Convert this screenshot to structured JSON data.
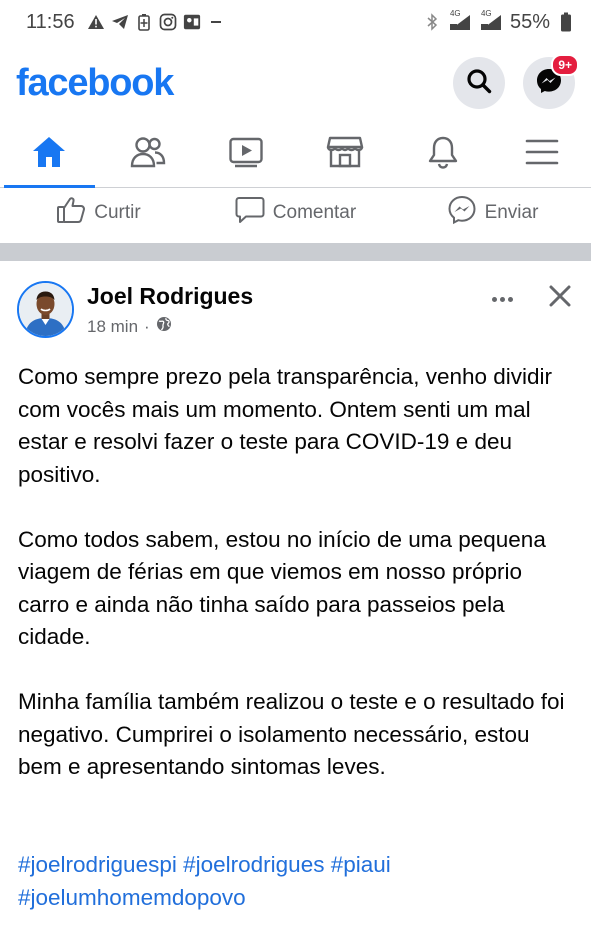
{
  "status_bar": {
    "time": "11:56",
    "battery": "55%",
    "network_label": "4G"
  },
  "header": {
    "logo": "facebook",
    "messenger_badge": "9+"
  },
  "nav": {
    "tabs": [
      {
        "name": "home-icon",
        "active": true
      },
      {
        "name": "friends-icon",
        "active": false
      },
      {
        "name": "watch-icon",
        "active": false
      },
      {
        "name": "marketplace-icon",
        "active": false
      },
      {
        "name": "notifications-icon",
        "active": false
      },
      {
        "name": "menu-icon",
        "active": false
      }
    ]
  },
  "actions": {
    "like": "Curtir",
    "comment": "Comentar",
    "send": "Enviar"
  },
  "post": {
    "author": "Joel Rodrigues",
    "time": "18 min",
    "separator": "·",
    "paragraphs": [
      "Como sempre prezo pela transparência, venho dividir com vocês mais um momento. Ontem senti um mal estar e resolvi fazer o teste para COVID-19 e deu positivo.",
      "Como todos sabem, estou no início de uma pequena viagem de férias em que viemos em nosso próprio carro e ainda não tinha saído para passeios pela cidade.",
      "Minha família também  realizou o teste e o resultado foi negativo. Cumprirei o isolamento necessário, estou bem e apresentando sintomas leves."
    ],
    "hashtags": [
      "#joelrodriguespi",
      "#joelrodrigues",
      "#piaui",
      "#joelumhomemdopovo"
    ]
  },
  "colors": {
    "brand": "#1877f2",
    "hashtag": "#216fdb",
    "muted": "#65676b",
    "badge": "#e41e3f"
  }
}
